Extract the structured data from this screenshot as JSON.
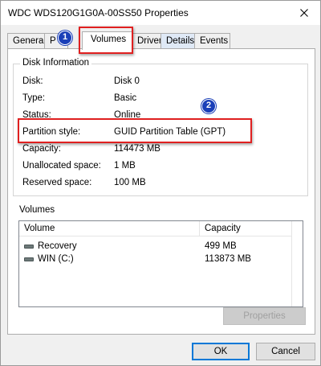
{
  "window": {
    "title": "WDC WDS120G1G0A-00SS50 Properties"
  },
  "tabs": [
    {
      "label": "General"
    },
    {
      "label": "P"
    },
    {
      "label": "Volumes"
    },
    {
      "label": "Driver"
    },
    {
      "label": "Details"
    },
    {
      "label": "Events"
    }
  ],
  "disk_info": {
    "legend": "Disk Information",
    "rows": [
      {
        "label": "Disk:",
        "value": "Disk 0"
      },
      {
        "label": "Type:",
        "value": "Basic"
      },
      {
        "label": "Status:",
        "value": "Online"
      },
      {
        "label": "Partition style:",
        "value": "GUID Partition Table (GPT)"
      },
      {
        "label": "Capacity:",
        "value": "114473 MB"
      },
      {
        "label": "Unallocated space:",
        "value": "1 MB"
      },
      {
        "label": "Reserved space:",
        "value": "100 MB"
      }
    ]
  },
  "volumes": {
    "legend": "Volumes",
    "columns": [
      "Volume",
      "Capacity"
    ],
    "rows": [
      {
        "name": "Recovery",
        "capacity": "499 MB"
      },
      {
        "name": "WIN (C:)",
        "capacity": "113873 MB"
      }
    ],
    "properties_label": "Properties"
  },
  "buttons": {
    "ok": "OK",
    "cancel": "Cancel"
  },
  "annotations": {
    "badge1": "1",
    "badge2": "2",
    "highlight_color": "#e02020",
    "badge_color": "#1a3fb8"
  }
}
